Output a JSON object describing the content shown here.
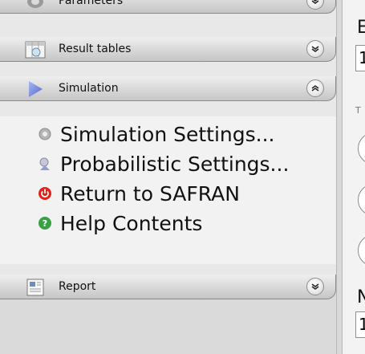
{
  "panels": {
    "parameters": {
      "label": "Parameters",
      "icon": "parameters-icon"
    },
    "result_tables": {
      "label": "Result tables",
      "icon": "table-calendar-icon"
    },
    "simulation": {
      "label": "Simulation",
      "icon": "play-triangle-icon",
      "expanded": true
    },
    "report": {
      "label": "Report",
      "icon": "report-icon"
    }
  },
  "simulation_menu": [
    {
      "label": "Simulation Settings...",
      "icon": "gear-icon"
    },
    {
      "label": "Probabilistic Settings...",
      "icon": "probabilistic-icon"
    },
    {
      "label": "Return to SAFRAN",
      "icon": "power-icon"
    },
    {
      "label": "Help Contents",
      "icon": "help-icon"
    }
  ],
  "right_panel": {
    "label_top": "E",
    "field_top": "1",
    "small_label": "T",
    "label_bottom": "N",
    "field_bottom": "1"
  },
  "colors": {
    "power_red": "#e0241a",
    "help_green": "#3aa045",
    "sim_triangle": "#6b7fd6"
  }
}
